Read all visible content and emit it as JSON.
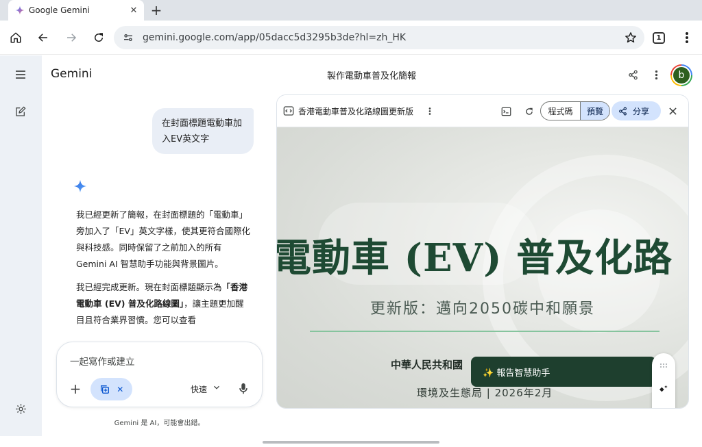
{
  "browser": {
    "tab_title": "Google Gemini",
    "url": "gemini.google.com/app/05dacc5d3295b3de?hl=zh_HK",
    "tab_count": "1"
  },
  "app": {
    "name": "Gemini",
    "conversation_title": "製作電動車普及化簡報",
    "avatar_letter": "b"
  },
  "chat": {
    "user_message": "在封面標題電動車加入EV英文字",
    "response_p1": "我已經更新了簡報，在封面標題的「電動車」旁加入了「EV」英文字樣，使其更符合國際化與科技感。同時保留了之前加入的所有 Gemini AI 智慧助手功能與背景圖片。",
    "response_p2_a": "我已經完成更新。現在封面標題顯示為",
    "response_p2_bold": "「香港電動車 (EV) 普及化路線圖」",
    "response_p2_b": "，讓主題更加醒目且符合業界習慣。您可以查看"
  },
  "composer": {
    "placeholder": "一起寫作或建立",
    "mode_label": "快速",
    "disclaimer": "Gemini 是 AI，可能會出錯。"
  },
  "canvas": {
    "doc_name": "香港電動車普及化路線圖更新版",
    "code_tab": "程式碼",
    "preview_tab": "預覽",
    "share_label": "分享",
    "slide": {
      "title": "電動車 (EV) 普及化路",
      "subtitle": "更新版：邁向2050碳中和願景",
      "org": "中華人民共和國",
      "dept": "環境及生態局 | 2026年2月",
      "assistant_label": "✨ 報告智慧助手"
    }
  },
  "colors": {
    "accent_blue": "#0b57d0",
    "chip_blue": "#d3e3fd",
    "slide_green": "#1e4a33",
    "assistant_bg": "#1e3f2e",
    "rule_green": "#86c49e"
  },
  "icons": [
    "gemini-favicon",
    "close-icon",
    "plus-icon",
    "home-icon",
    "back-icon",
    "forward-icon",
    "reload-icon",
    "site-settings-icon",
    "star-icon",
    "more-vert-icon",
    "hamburger-icon",
    "new-chat-icon",
    "settings-icon",
    "share-icon",
    "gemini-spark-icon",
    "code-icon",
    "terminal-icon",
    "mic-icon",
    "chevron-down-icon",
    "drag-handle-icon",
    "magic-edit-icon",
    "collapse-icon"
  ]
}
